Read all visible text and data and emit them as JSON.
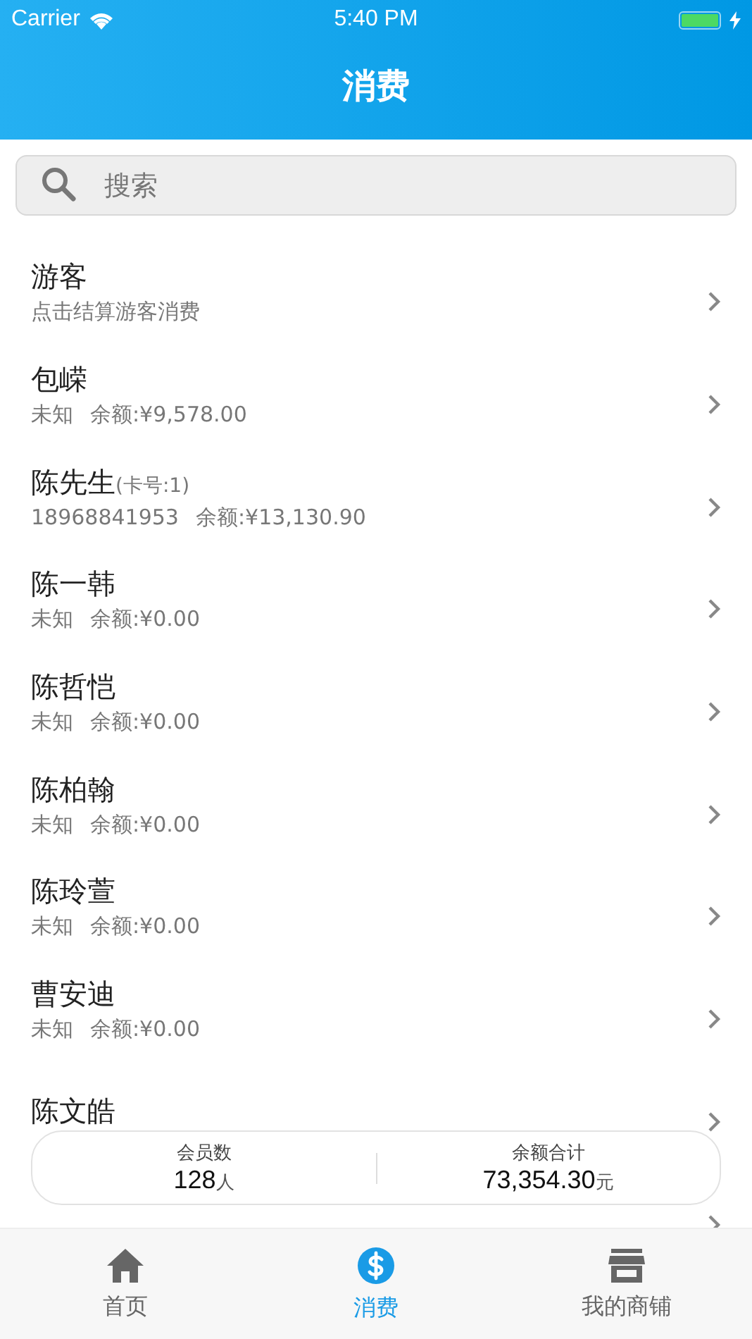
{
  "status_bar": {
    "carrier": "Carrier",
    "time": "5:40 PM"
  },
  "nav": {
    "title": "消费"
  },
  "search": {
    "placeholder": "搜索"
  },
  "members": [
    {
      "name": "游客",
      "sub": [
        "点击结算游客消费"
      ]
    },
    {
      "name": "包嵘",
      "sub": [
        "未知",
        "余额:¥9,578.00"
      ]
    },
    {
      "name": "陈先生",
      "tag": "(卡号:1)",
      "sub": [
        "18968841953",
        "余额:¥13,130.90"
      ]
    },
    {
      "name": "陈一韩",
      "sub": [
        "未知",
        "余额:¥0.00"
      ]
    },
    {
      "name": "陈哲恺",
      "sub": [
        "未知",
        "余额:¥0.00"
      ]
    },
    {
      "name": "陈柏翰",
      "sub": [
        "未知",
        "余额:¥0.00"
      ]
    },
    {
      "name": "陈玲萱",
      "sub": [
        "未知",
        "余额:¥0.00"
      ]
    },
    {
      "name": "曹安迪",
      "sub": [
        "未知",
        "余额:¥0.00"
      ]
    },
    {
      "name": "陈文皓"
    }
  ],
  "summary": [
    {
      "label": "会员数",
      "value": "128",
      "unit": "人"
    },
    {
      "label": "余额合计",
      "value": "73,354.30",
      "unit": "元"
    }
  ],
  "tabs": [
    {
      "label": "首页",
      "kind": "home",
      "selected": false
    },
    {
      "label": "消费",
      "kind": "pay",
      "selected": true
    },
    {
      "label": "我的商铺",
      "kind": "shop",
      "selected": false
    }
  ]
}
